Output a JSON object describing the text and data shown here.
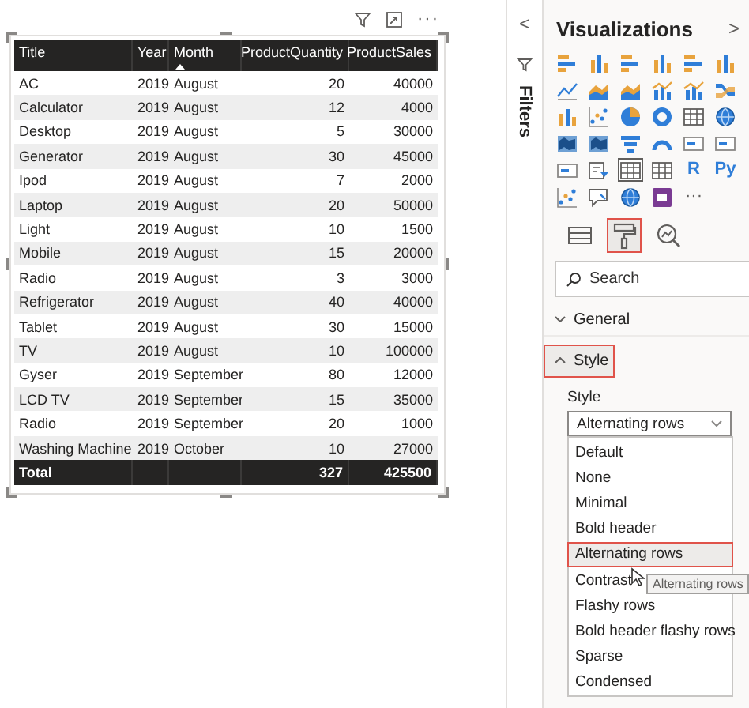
{
  "visual_header": {
    "more": "···"
  },
  "table": {
    "columns": [
      {
        "label": "Title",
        "kind": "text",
        "sorted": false
      },
      {
        "label": "Year",
        "kind": "text",
        "sorted": false
      },
      {
        "label": "Month",
        "kind": "text",
        "sorted": true
      },
      {
        "label": "ProductQuantity",
        "kind": "number",
        "sorted": false
      },
      {
        "label": "ProductSales",
        "kind": "number",
        "sorted": false
      }
    ],
    "rows": [
      [
        "AC",
        "2019",
        "August",
        "20",
        "40000"
      ],
      [
        "Calculator",
        "2019",
        "August",
        "12",
        "4000"
      ],
      [
        "Desktop",
        "2019",
        "August",
        "5",
        "30000"
      ],
      [
        "Generator",
        "2019",
        "August",
        "30",
        "45000"
      ],
      [
        "Ipod",
        "2019",
        "August",
        "7",
        "2000"
      ],
      [
        "Laptop",
        "2019",
        "August",
        "20",
        "50000"
      ],
      [
        "Light",
        "2019",
        "August",
        "10",
        "1500"
      ],
      [
        "Mobile",
        "2019",
        "August",
        "15",
        "20000"
      ],
      [
        "Radio",
        "2019",
        "August",
        "3",
        "3000"
      ],
      [
        "Refrigerator",
        "2019",
        "August",
        "40",
        "40000"
      ],
      [
        "Tablet",
        "2019",
        "August",
        "30",
        "15000"
      ],
      [
        "TV",
        "2019",
        "August",
        "10",
        "100000"
      ],
      [
        "Gyser",
        "2019",
        "September",
        "80",
        "12000"
      ],
      [
        "LCD TV",
        "2019",
        "September",
        "15",
        "35000"
      ],
      [
        "Radio",
        "2019",
        "September",
        "20",
        "1000"
      ],
      [
        "Washing Machine",
        "2019",
        "October",
        "10",
        "27000"
      ]
    ],
    "total": {
      "label": "Total",
      "quantity": "327",
      "sales": "425500"
    }
  },
  "filters_pane": {
    "toggle": "<",
    "title": "Filters"
  },
  "visualizations": {
    "title": "Visualizations",
    "toggle": ">",
    "gallery": [
      {
        "kind": "hbar",
        "selected": false
      },
      {
        "kind": "vbar",
        "selected": false
      },
      {
        "kind": "hbar",
        "selected": false
      },
      {
        "kind": "vbar",
        "selected": false
      },
      {
        "kind": "hbar",
        "selected": false
      },
      {
        "kind": "vbar",
        "selected": false
      },
      {
        "kind": "line",
        "selected": false
      },
      {
        "kind": "area",
        "selected": false
      },
      {
        "kind": "area",
        "selected": false
      },
      {
        "kind": "combo",
        "selected": false
      },
      {
        "kind": "combo",
        "selected": false
      },
      {
        "kind": "ribbon",
        "selected": false
      },
      {
        "kind": "vbar",
        "selected": false
      },
      {
        "kind": "scatter",
        "selected": false
      },
      {
        "kind": "pie",
        "selected": false
      },
      {
        "kind": "donut",
        "selected": false
      },
      {
        "kind": "grid",
        "selected": false
      },
      {
        "kind": "globe",
        "selected": false
      },
      {
        "kind": "map",
        "selected": false
      },
      {
        "kind": "map",
        "selected": false
      },
      {
        "kind": "funnel",
        "selected": false
      },
      {
        "kind": "gauge",
        "selected": false
      },
      {
        "kind": "card",
        "selected": false
      },
      {
        "kind": "card",
        "selected": false
      },
      {
        "kind": "card",
        "selected": false
      },
      {
        "kind": "slicer",
        "selected": false
      },
      {
        "kind": "grid",
        "selected": true
      },
      {
        "kind": "grid",
        "selected": false
      },
      {
        "kind": "text",
        "text": "R",
        "selected": false
      },
      {
        "kind": "text",
        "text": "Py",
        "selected": false
      },
      {
        "kind": "scatter",
        "selected": false
      },
      {
        "kind": "chat",
        "selected": false
      },
      {
        "kind": "globe",
        "selected": false
      },
      {
        "kind": "app",
        "selected": false
      },
      {
        "kind": "text",
        "text": "···",
        "selected": false
      }
    ],
    "tabs": [
      {
        "kind": "fields",
        "selected": false
      },
      {
        "kind": "format",
        "selected": true
      },
      {
        "kind": "analytics",
        "selected": false
      }
    ],
    "search": {
      "placeholder": "Search"
    },
    "sections": [
      {
        "title": "General",
        "expanded": false,
        "highlighted": false
      },
      {
        "title": "Style",
        "expanded": true,
        "highlighted": true
      }
    ],
    "style_field": {
      "label": "Style",
      "value": "Alternating rows"
    },
    "dropdown": {
      "options": [
        {
          "label": "Default",
          "selected": false
        },
        {
          "label": "None",
          "selected": false
        },
        {
          "label": "Minimal",
          "selected": false
        },
        {
          "label": "Bold header",
          "selected": false
        },
        {
          "label": "Alternating rows",
          "selected": true
        },
        {
          "label": "Contrast",
          "selected": false
        },
        {
          "label": "Flashy rows",
          "selected": false
        },
        {
          "label": "Bold header flashy rows",
          "selected": false
        },
        {
          "label": "Sparse",
          "selected": false
        },
        {
          "label": "Condensed",
          "selected": false
        }
      ],
      "tooltip": "Alternating rows"
    }
  }
}
